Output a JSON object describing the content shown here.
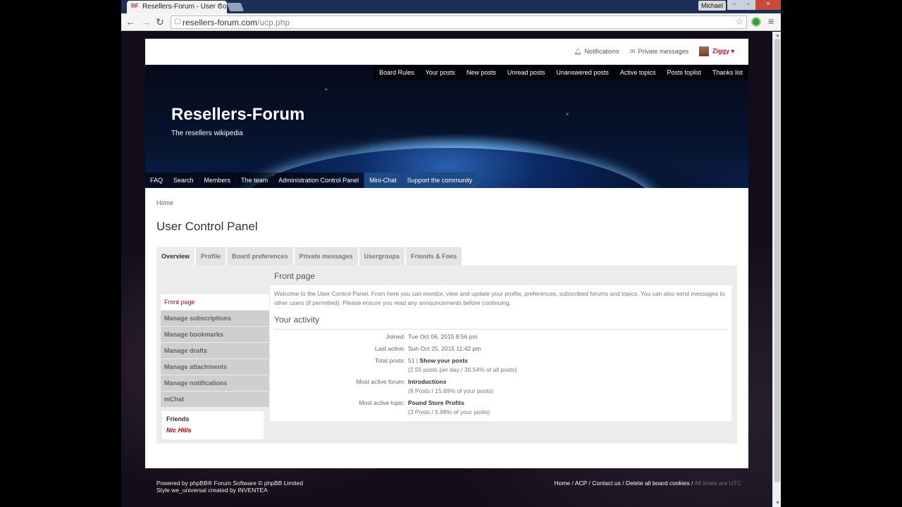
{
  "browser": {
    "tab_title": "Resellers-Forum - User Co",
    "tab_close": "×",
    "favicon": "RF",
    "user_chip": "Michael",
    "url_host": "resellers-forum.com",
    "url_path": "/ucp.php",
    "back": "←",
    "forward": "→",
    "reload": "↻",
    "star": "☆",
    "menu": "≡"
  },
  "topbar": {
    "notifications": "Notifications",
    "private_messages": "Private messages",
    "username": "Ziggy",
    "caret": "▾"
  },
  "header": {
    "nav": [
      "Board Rules",
      "Your posts",
      "New posts",
      "Unread posts",
      "Unanswered posts",
      "Active topics",
      "Posts toplist",
      "Thanks list"
    ],
    "site_title": "Resellers-Forum",
    "site_desc": "The resellers wikipedia",
    "main_nav": [
      "FAQ",
      "Search",
      "Members",
      "The team",
      "Administration Control Panel",
      "Mini-Chat",
      "Support the community"
    ]
  },
  "breadcrumb": "Home",
  "page_title": "User Control Panel",
  "tabs": [
    "Overview",
    "Profile",
    "Board preferences",
    "Private messages",
    "Usergroups",
    "Friends & Foes"
  ],
  "sidemenu": [
    "Front page",
    "Manage subscriptions",
    "Manage bookmarks",
    "Manage drafts",
    "Manage attachments",
    "Manage notifications",
    "mChat"
  ],
  "friends": {
    "heading": "Friends",
    "name": "Nic Hills"
  },
  "main": {
    "heading": "Front page",
    "welcome": "Welcome to the User Control Panel. From here you can monitor, view and update your profile, preferences, subscribed forums and topics. You can also send messages to other users (if permitted). Please ensure you read any announcements before continuing.",
    "activity_heading": "Your activity",
    "joined_label": "Joined:",
    "joined_value": "Tue Oct 06, 2015 8:56 pm",
    "last_active_label": "Last active:",
    "last_active_value": "Sun Oct 25, 2015 11:42 pm",
    "total_posts_label": "Total posts:",
    "total_posts_value": "51 |",
    "show_posts": "Show your posts",
    "posts_sub": "(2.55 posts per day / 30.54% of all posts)",
    "active_forum_label": "Most active forum:",
    "active_forum_value": "Introductions",
    "active_forum_sub": "(8 Posts / 15.69% of your posts)",
    "active_topic_label": "Most active topic:",
    "active_topic_value": "Pound Store Profits",
    "active_topic_sub": "(3 Posts / 5.88% of your posts)"
  },
  "footer": {
    "powered": "Powered by phpBB® Forum Software © phpBB Limited",
    "style": "Style we_universal created by INVENTEA",
    "links": [
      "Home",
      "ACP",
      "Contact us",
      "Delete all board cookies"
    ],
    "timezone": "All times are UTC",
    "sep": "/"
  }
}
